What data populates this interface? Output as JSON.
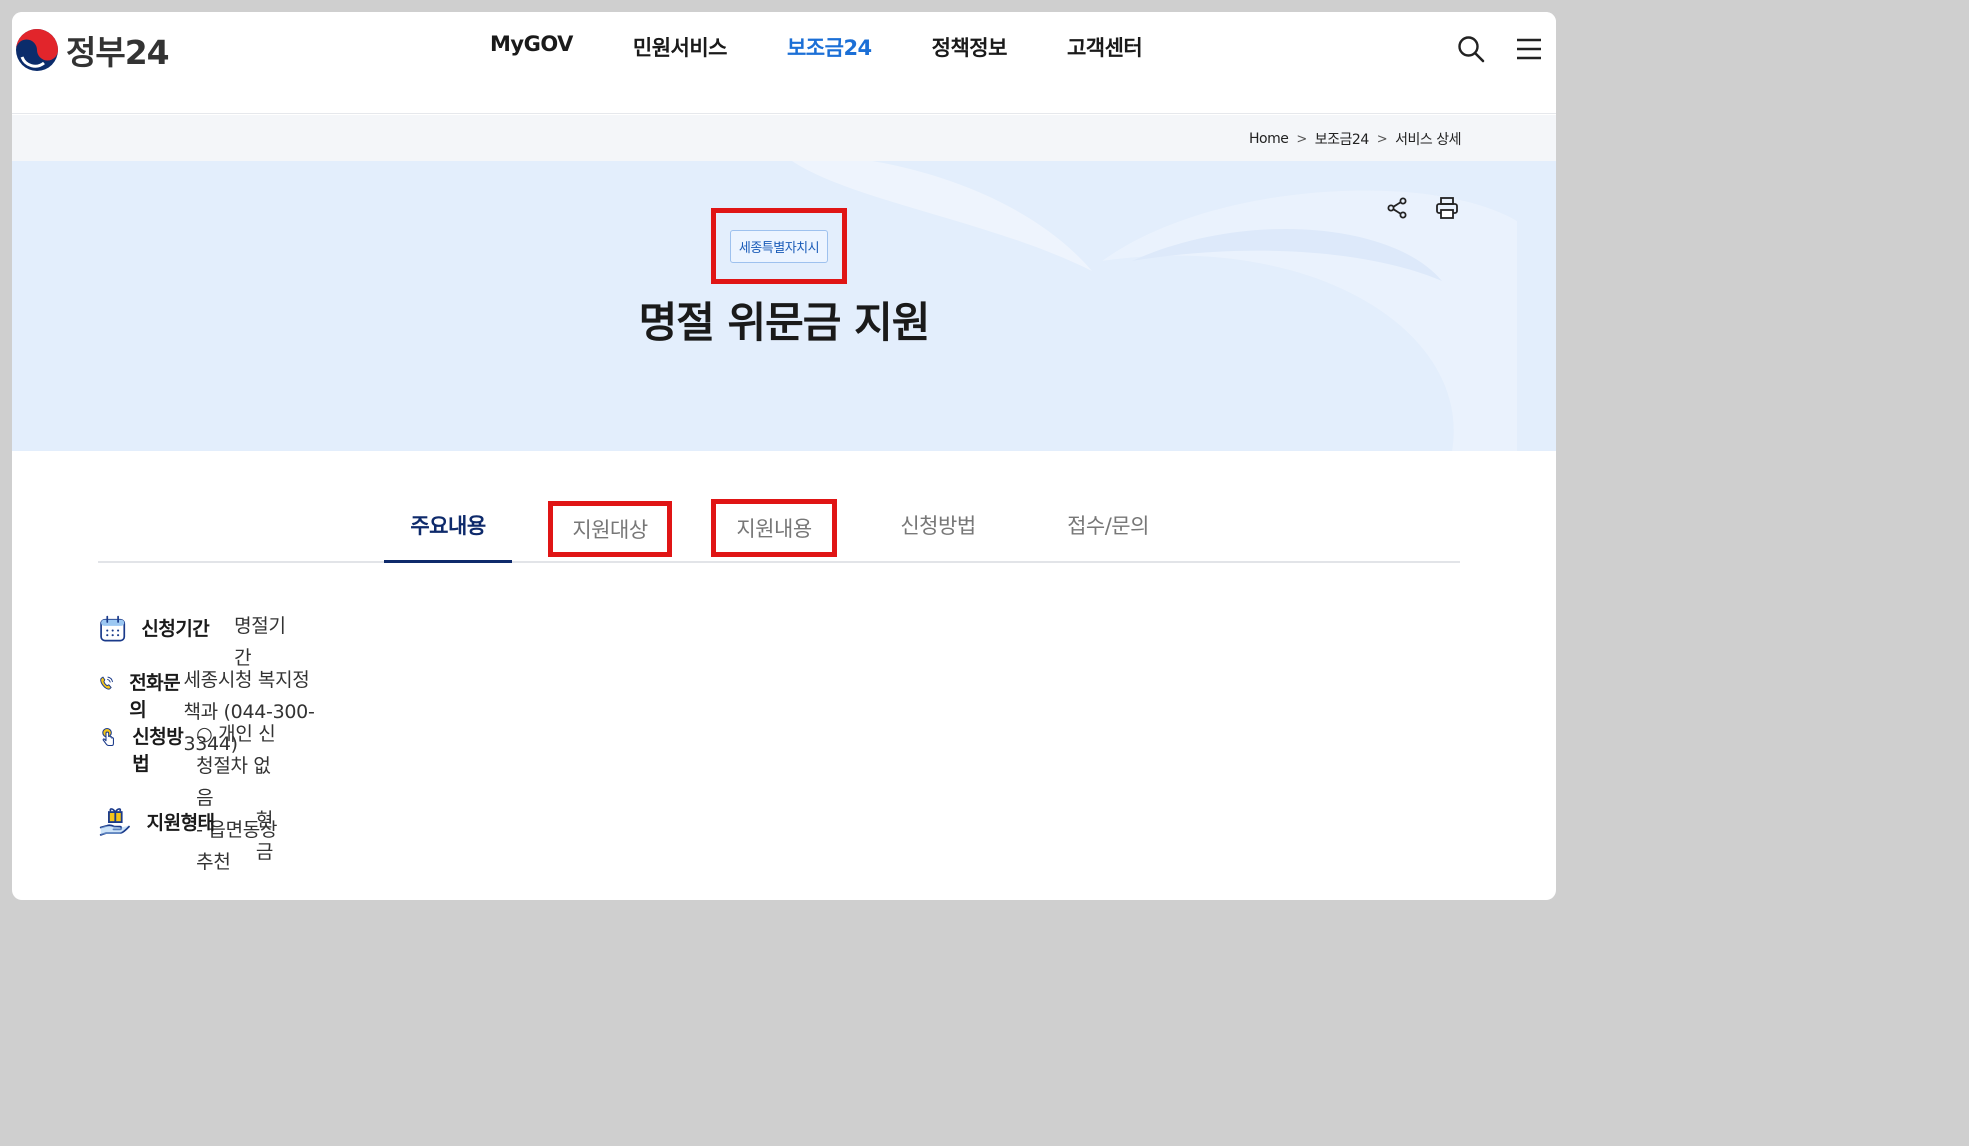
{
  "header": {
    "logo_text": "정부24",
    "nav": [
      {
        "label": "MyGOV",
        "active": false
      },
      {
        "label": "민원서비스",
        "active": false
      },
      {
        "label": "보조금24",
        "active": true
      },
      {
        "label": "정책정보",
        "active": false
      },
      {
        "label": "고객센터",
        "active": false
      }
    ],
    "icons": [
      "search-icon",
      "menu-icon"
    ]
  },
  "breadcrumb": {
    "items": [
      "Home",
      "보조금24",
      "서비스 상세"
    ],
    "separator": ">"
  },
  "hero": {
    "region_badge": "세종특별자치시",
    "title": "명절 위문금 지원",
    "actions": [
      "share-icon",
      "print-icon"
    ]
  },
  "tabs": [
    {
      "label": "주요내용",
      "active": true,
      "highlighted": false
    },
    {
      "label": "지원대상",
      "active": false,
      "highlighted": true
    },
    {
      "label": "지원내용",
      "active": false,
      "highlighted": true
    },
    {
      "label": "신청방법",
      "active": false,
      "highlighted": false
    },
    {
      "label": "접수/문의",
      "active": false,
      "highlighted": false
    }
  ],
  "info": [
    {
      "icon": "calendar-icon",
      "label": "신청기간",
      "value": [
        "명절기간"
      ]
    },
    {
      "icon": "phone-icon",
      "label": "전화문의",
      "value": [
        "세종시청 복지정책과 (044-300-3344)"
      ]
    },
    {
      "icon": "pointer-hand-icon",
      "label": "신청방법",
      "value": [
        "○ 개인 신청절차 없음",
        "- 읍면동장 추천"
      ]
    },
    {
      "icon": "gift-hand-icon",
      "label": "지원형태",
      "value": [
        "현금"
      ]
    }
  ],
  "colors": {
    "accent": "#1b6fd6",
    "tab_active": "#0e2a6b",
    "hero_bg": "#e3eefc",
    "highlight_box": "#e01515"
  }
}
